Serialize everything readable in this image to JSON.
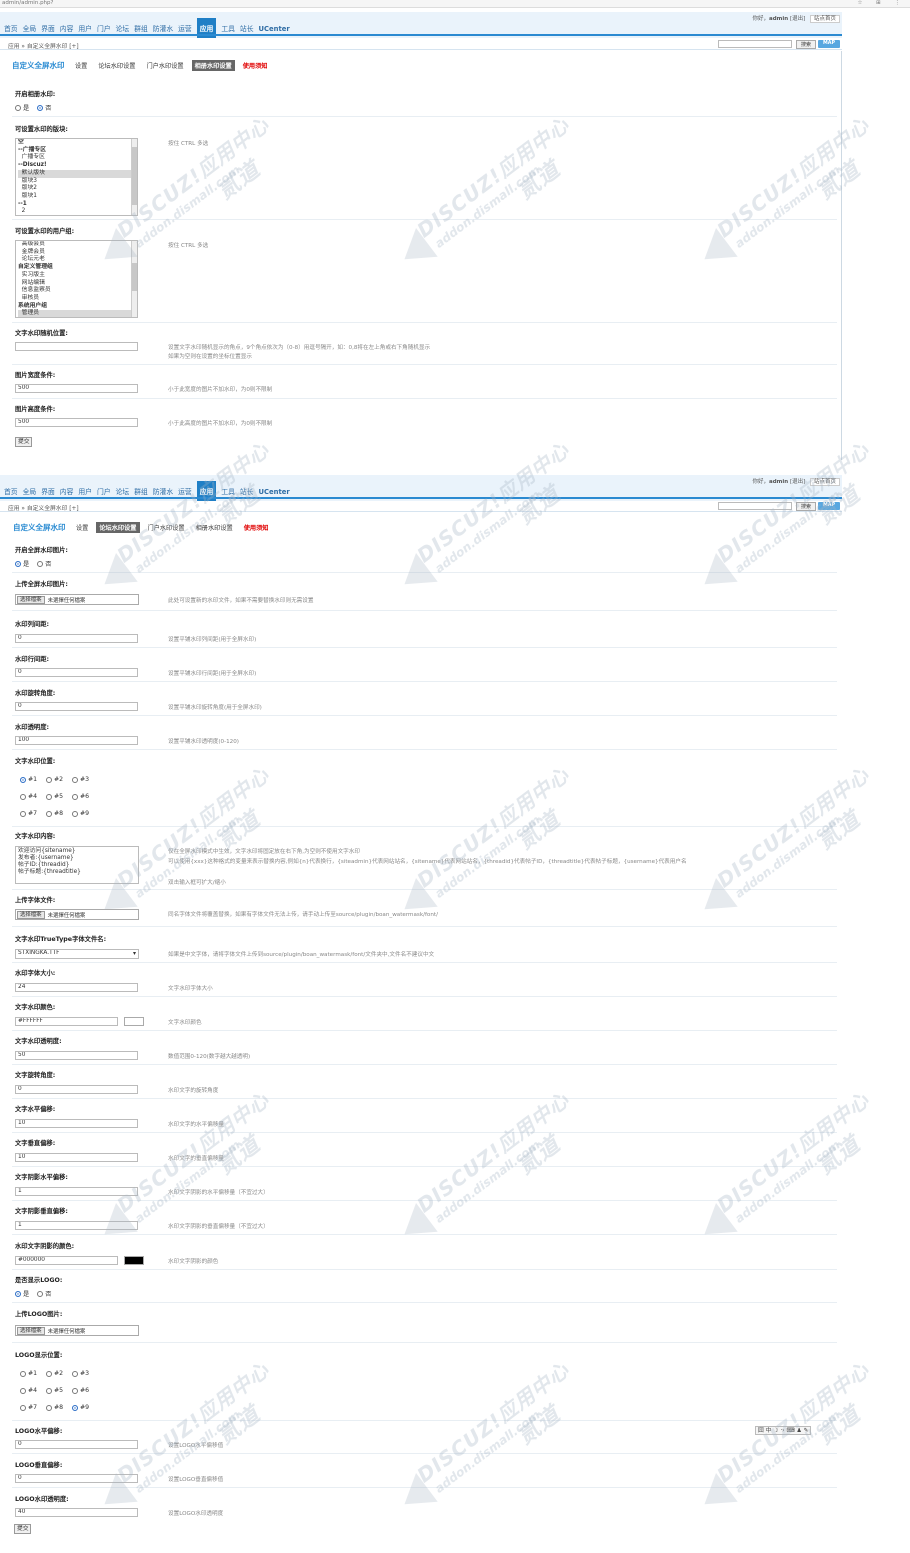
{
  "browser": {
    "url": "admin/admin.php?",
    "icons": "☆ ⊞ ⋮"
  },
  "nav": {
    "items": [
      "首页",
      "全局",
      "界面",
      "内容",
      "用户",
      "门户",
      "论坛",
      "群组",
      "防灌水",
      "运营",
      "应用",
      "工具",
      "站长",
      "UCenter"
    ],
    "active": "应用",
    "greeting": "你好，",
    "username": "admin",
    "logout": "[退出]",
    "site_home": "站点首页"
  },
  "crumb": {
    "text": "应用 » 自定义全屏水印 [+]"
  },
  "search": {
    "button": "搜索",
    "map": "MAP"
  },
  "plugin": {
    "title": "自定义全屏水印",
    "tabs": [
      "设置",
      "论坛水印设置",
      "门户水印设置",
      "相册水印设置",
      "使用须知"
    ]
  },
  "watermark": {
    "brand": "DISCUZ!应用中心",
    "domain": "addon.dismall.com",
    "author": "贰道"
  },
  "panel1": {
    "enable_label": "开启相册水印:",
    "yes": "是",
    "no": "否",
    "forums_label": "可设置水印的版块:",
    "forums_list": [
      "空",
      "--广播专区",
      "  广播专区",
      "--Discuz!",
      "  默认版块",
      "  版块3",
      "  版块2",
      "  版块1",
      "--1",
      "  2"
    ],
    "forums_selected": "  默认版块",
    "forums_tip": "按住 CTRL 多选",
    "groups_label": "可设置水印的用户组:",
    "groups_list": [
      "  高级会员",
      "  金牌会员",
      "  论坛元老",
      "自定义管理组",
      "  实习版主",
      "  网站编辑",
      "  信息监察员",
      "  审核员",
      "系统用户组",
      "  管理员"
    ],
    "groups_selected": "  管理员",
    "groups_tip": "按住 CTRL 多选",
    "random_label": "文字水印随机位置:",
    "random_value": "",
    "random_tip1": "设置文字水印随机显示的角点，9个角点依次为（0-8）用逗号隔开，如：0,8将在左上角或右下角随机显示",
    "random_tip2": "如果为空则在设置的坐标位置显示",
    "width_label": "图片宽度条件:",
    "width_value": "500",
    "width_tip": "小于此宽度的图片不加水印，为0则不限制",
    "height_label": "图片高度条件:",
    "height_value": "500",
    "height_tip": "小于此高度的图片不加水印，为0则不限制",
    "submit": "提交"
  },
  "panel2": {
    "enable_label": "开启全屏水印图片:",
    "yes": "是",
    "no": "否",
    "upload_label": "上传全屏水印图片:",
    "file_btn": "选择檔案",
    "file_none": "未選擇任何檔案",
    "upload_tip": "此处可设置新的水印文件，如果不需要替换水印则无需设置",
    "col_label": "水印列间距:",
    "col_value": "0",
    "col_tip": "设置平铺水印列间距(用于全屏水印)",
    "row_label": "水印行间距:",
    "row_value": "0",
    "row_tip": "设置平铺水印行间距(用于全屏水印)",
    "rot_label": "水印旋转角度:",
    "rot_value": "0",
    "rot_tip": "设置平铺水印旋转角度(用于全屏水印)",
    "alpha_label": "水印透明度:",
    "alpha_value": "100",
    "alpha_tip": "设置平铺水印透明度(0-120)",
    "pos_label": "文字水印位置:",
    "pos_options": [
      "#1",
      "#2",
      "#3",
      "#4",
      "#5",
      "#6",
      "#7",
      "#8",
      "#9"
    ],
    "pos_selected": "#1",
    "text_label": "文字水印内容:",
    "text_lines": [
      "欢迎访问{sitename}",
      "发布者:{username}",
      "帖子ID:{threadid}",
      "帖子标题:{threadtitle}"
    ],
    "text_tip1": "仅在全屏水印模式中生效，文字水印将固定放在右下角,为空则不使用文字水印",
    "text_tip2": "可以使用{xxx}这种格式的变量来表示替换内容,例如{n}代表换行，{siteadmin}代表网站站名，{sitename}代表网站站名，{threadid}代表帖子ID，{threadtitle}代表帖子标题，{username}代表用户名",
    "text_tip3": "双击输入框可扩大/缩小",
    "font_upload_label": "上传字体文件:",
    "font_upload_tip": "同名字体文件将覆盖替换，如果有字体文件无法上传，请手动上传至source/plugin/boan_watermask/font/",
    "font_name_label": "文字水印TrueType字体文件名:",
    "font_name_value": "STXINGKA.TTF",
    "font_name_tip": "如果是中文字体，请将字体文件上传到source/plugin/boan_watermask/font/文件夹中,文件名不建议中文",
    "font_size_label": "水印字体大小:",
    "font_size_value": "24",
    "font_size_tip": "文字水印字体大小",
    "color_label": "文字水印颜色:",
    "color_value": "#FFFFFF",
    "color_tip": "文字水印颜色",
    "talpha_label": "文字水印透明度:",
    "talpha_value": "50",
    "talpha_tip": "数值范围0-120(数字越大越透明)",
    "trot_label": "文字旋转角度:",
    "trot_value": "0",
    "trot_tip": "水印文字的旋转角度",
    "hoff_label": "文字水平偏移:",
    "hoff_value": "10",
    "hoff_tip": "水印文字的水平偏移量",
    "voff_label": "文字垂直偏移:",
    "voff_value": "10",
    "voff_tip": "水印文字的垂直偏移量",
    "shoff_label": "文字阴影水平偏移:",
    "shoff_value": "1",
    "shoff_tip": "水印文字阴影的水平偏移量（不宜过大）",
    "svoff_label": "文字阴影垂直偏移:",
    "svoff_value": "1",
    "svoff_tip": "水印文字阴影的垂直偏移量（不宜过大）",
    "shcolor_label": "水印文字阴影的颜色:",
    "shcolor_value": "#000000",
    "shcolor_tip": "水印文字阴影的颜色",
    "logo_show_label": "是否显示LOGO:",
    "logo_upload_label": "上传LOGO图片:",
    "logo_pos_label": "LOGO显示位置:",
    "logo_pos_selected": "#9",
    "logo_h_label": "LOGO水平偏移:",
    "logo_h_value": "0",
    "logo_h_tip": "设置LOGO水平偏移值",
    "logo_v_label": "LOGO垂直偏移:",
    "logo_v_value": "0",
    "logo_v_tip": "设置LOGO垂直偏移值",
    "logo_a_label": "LOGO水印透明度:",
    "logo_a_value": "40",
    "logo_a_tip": "设置LOGO水印透明度",
    "submit": "提交",
    "ime": "囧 中 ☽ ·› ⌨ ♟ ✎"
  },
  "colors": {
    "accent": "#2a8bd2",
    "nav_active": "#1f7fc6",
    "text_color_swatch": "#FFFFFF",
    "shadow_swatch": "#000000",
    "danger": "#e00000"
  }
}
